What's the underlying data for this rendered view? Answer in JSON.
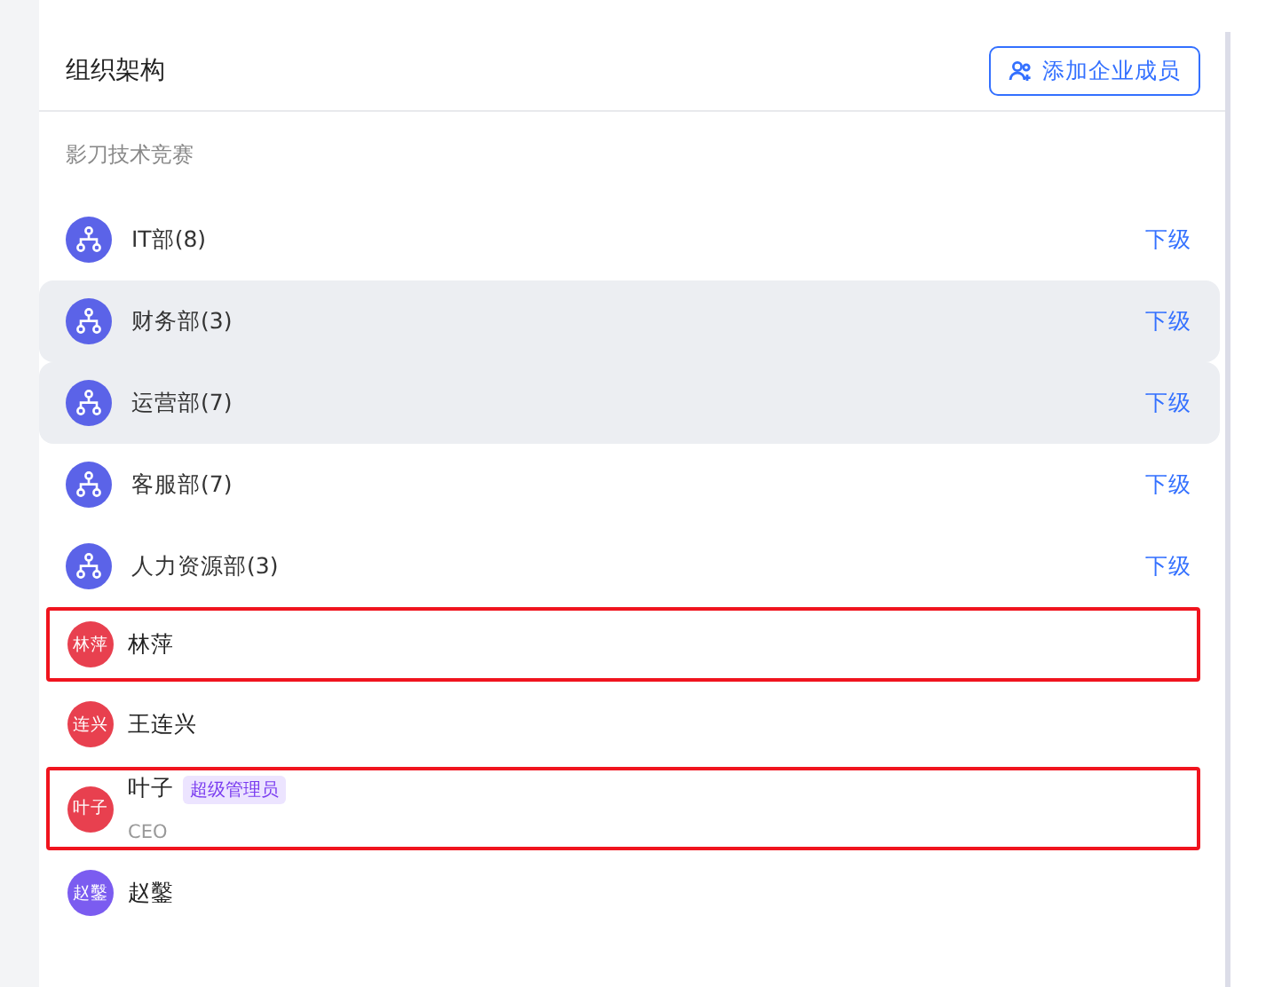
{
  "header": {
    "title": "组织架构",
    "add_button": "添加企业成员"
  },
  "company": "影刀技术竞赛",
  "departments": [
    {
      "name": "IT部(8)",
      "link": "下级",
      "shaded": false
    },
    {
      "name": "财务部(3)",
      "link": "下级",
      "shaded": true
    },
    {
      "name": "运营部(7)",
      "link": "下级",
      "shaded": true
    },
    {
      "name": "客服部(7)",
      "link": "下级",
      "shaded": false
    },
    {
      "name": "人力资源部(3)",
      "link": "下级",
      "shaded": false
    }
  ],
  "members": [
    {
      "avatar": "林萍",
      "name": "林萍",
      "color": "#e8404f",
      "highlighted": true
    },
    {
      "avatar": "连兴",
      "name": "王连兴",
      "color": "#e8404f",
      "highlighted": false
    },
    {
      "avatar": "叶子",
      "name": "叶子",
      "badge": "超级管理员",
      "title": "CEO",
      "color": "#e8404f",
      "highlighted": true
    },
    {
      "avatar": "赵鑿",
      "name": "赵鑿",
      "color": "#7b5cf0",
      "highlighted": false
    }
  ]
}
